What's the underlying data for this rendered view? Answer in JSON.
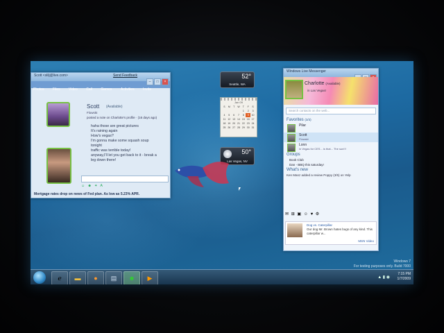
{
  "chat_window": {
    "title": "Scott <slilj@live.com>",
    "feedback_link": "Send Feedback",
    "menu": [
      "Photos",
      "Files",
      "Video",
      "Call",
      "Games",
      "Activities",
      "Invite"
    ],
    "contact_name": "Scott",
    "contact_status": "(Available)",
    "contact_status_word": "Flowskt",
    "contact_note": "posted a note on Charlotte's profile · (16 days ago)",
    "messages": [
      "haha those are great pictures",
      "It's raining again",
      "How's vegas?",
      "I'm gonna make some squash soup",
      "tonight",
      "traffic was terrible today!",
      "anyway,I'll let you get back to it - break a",
      "leg down there!"
    ],
    "toolbar_icons": [
      "smiley-icon",
      "wink-icon",
      "nudge-icon",
      "font-icon"
    ],
    "news_ticker": "Mortgage rates drop on news of Fed plan. As low as 5.23% APR."
  },
  "gadgets": {
    "weather_top": {
      "temp": "52°",
      "city": "Seattle, WA"
    },
    "calendar": {
      "month": "Jan 09",
      "days": [
        "S",
        "M",
        "T",
        "W",
        "T",
        "F",
        "S",
        "",
        "",
        "",
        "",
        "1",
        "2",
        "3",
        "4",
        "5",
        "6",
        "7",
        "8",
        "9",
        "10",
        "11",
        "12",
        "13",
        "14",
        "15",
        "16",
        "17",
        "18",
        "19",
        "20",
        "21",
        "22",
        "23",
        "24",
        "25",
        "26",
        "27",
        "28",
        "29",
        "30",
        "31"
      ],
      "today": "9"
    },
    "weather_bottom": {
      "temp": "50°",
      "city": "Las Vegas, NV"
    }
  },
  "messenger": {
    "title": "Windows Live Messenger",
    "user_name": "Charlotte",
    "user_status": "(Available)",
    "user_message": "in Las Vegas!",
    "search_placeholder": "Search contacts on the web...",
    "favorites_label": "Favorites",
    "favorites_count": "(3/3)",
    "contacts": [
      {
        "name": "Pilar",
        "status": ""
      },
      {
        "name": "Scott",
        "status": "Flowskt"
      },
      {
        "name": "Lonn",
        "status": "in Vegas for CES... is that... The sun!!!"
      }
    ],
    "groups_label": "Groups",
    "groups": [
      "Book Club",
      "Dan - BBQ this saturday!"
    ],
    "whats_new_label": "What's new",
    "whats_new_item": "Ken Manz added a review Poppy (3/5) on Yelp",
    "ad": {
      "title": "Dog vs. Caterpillar",
      "text": "Our dog Mr. Brown hates bugs of any kind. This caterpillar w...",
      "source": "MSN Video"
    }
  },
  "watermark": {
    "line1": "Windows 7",
    "line2": "For testing purposes only. Build 7000"
  },
  "taskbar": {
    "time": "7:15 PM",
    "date": "1/7/2009",
    "buttons": [
      "ie-icon",
      "folder-icon",
      "media-icon",
      "sidebar-icon",
      "messenger-icon",
      "play-icon"
    ]
  }
}
